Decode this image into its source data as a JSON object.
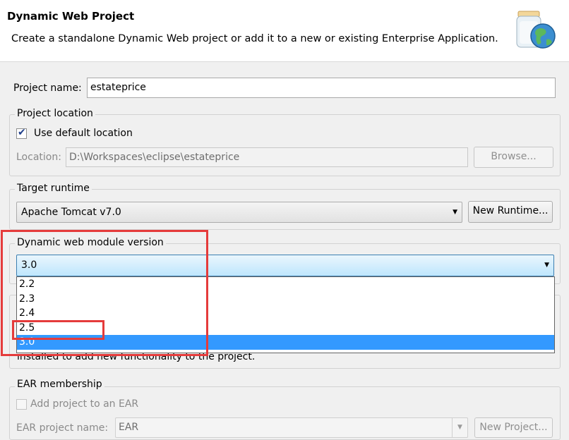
{
  "header": {
    "title": "Dynamic Web Project",
    "description": "Create a standalone Dynamic Web project or add it to a new or existing Enterprise Application."
  },
  "project_name": {
    "label": "Project name:",
    "value": "estateprice"
  },
  "project_location": {
    "group_label": "Project location",
    "use_default_label": "Use default location",
    "use_default_checked": true,
    "location_label": "Location:",
    "location_value": "D:\\Workspaces\\eclipse\\estateprice",
    "browse_label": "Browse..."
  },
  "target_runtime": {
    "group_label": "Target runtime",
    "selected": "Apache Tomcat v7.0",
    "new_runtime_label": "New Runtime..."
  },
  "module_version": {
    "group_label": "Dynamic web module version",
    "selected": "3.0",
    "options": [
      "2.2",
      "2.3",
      "2.4",
      "2.5",
      "3.0"
    ]
  },
  "configuration": {
    "partial_text": "installed to add new functionality to the project."
  },
  "ear_membership": {
    "group_label": "EAR membership",
    "add_label": "Add project to an EAR",
    "ear_name_label": "EAR project name:",
    "ear_name_value": "EAR",
    "new_project_label": "New Project..."
  },
  "colors": {
    "highlight": "#e53b3b",
    "list_selection": "#3399ff"
  }
}
